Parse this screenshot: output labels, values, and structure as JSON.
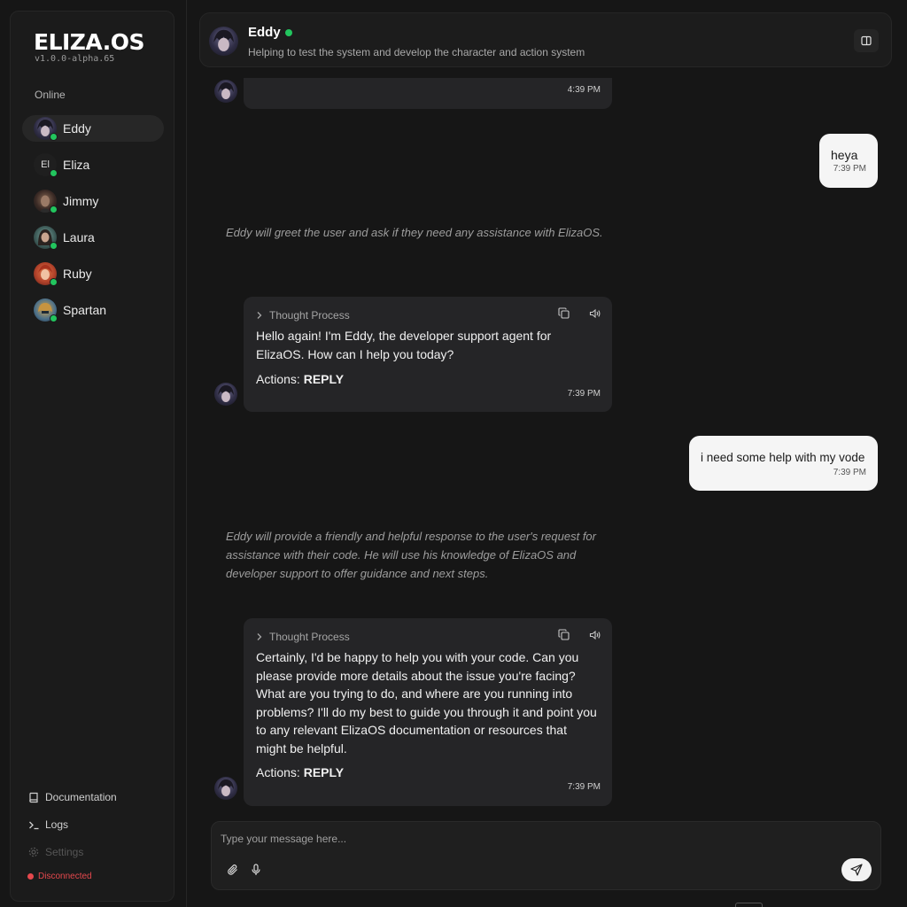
{
  "sidebar": {
    "logo": "ELIZA.OS",
    "version": "v1.0.0-alpha.65",
    "section_label": "Online",
    "agents": [
      {
        "name": "Eddy",
        "initials": ""
      },
      {
        "name": "Eliza",
        "initials": "El"
      },
      {
        "name": "Jimmy",
        "initials": ""
      },
      {
        "name": "Laura",
        "initials": ""
      },
      {
        "name": "Ruby",
        "initials": ""
      },
      {
        "name": "Spartan",
        "initials": ""
      }
    ],
    "links": {
      "documentation": "Documentation",
      "logs": "Logs",
      "settings": "Settings"
    },
    "connection_status": "Disconnected"
  },
  "header": {
    "name": "Eddy",
    "description": "Helping to test the system and develop the character and action system"
  },
  "messages": {
    "m0": {
      "time": "4:39 PM"
    },
    "m1": {
      "text": "heya",
      "time": "7:39 PM"
    },
    "t1": {
      "text": "Eddy will greet the user and ask if they need any assistance with ElizaOS."
    },
    "m2": {
      "thought_label": "Thought Process",
      "text": "Hello again! I'm Eddy, the developer support agent for ElizaOS. How can I help you today?",
      "actions_label": "Actions:",
      "actions_value": "REPLY",
      "time": "7:39 PM"
    },
    "m3": {
      "text": "i need some help with my vode",
      "time": "7:39 PM"
    },
    "t2": {
      "text": "Eddy will provide a friendly and helpful response to the user's request for assistance with their code. He will use his knowledge of ElizaOS and developer support to offer guidance and next steps."
    },
    "m4": {
      "thought_label": "Thought Process",
      "text": "Certainly, I'd be happy to help you with your code. Can you please provide more details about the issue you're facing? What are you trying to do, and where are you running into problems? I'll do my best to guide you through it and point you to any relevant ElizaOS documentation or resources that might be helpful.",
      "actions_label": "Actions:",
      "actions_value": "REPLY",
      "time": "7:39 PM"
    }
  },
  "composer": {
    "placeholder": "Type your message here..."
  },
  "colors": {
    "online": "#22c55e",
    "disconnected": "#e5484d",
    "agent_bubble": "#252527",
    "user_bubble": "#f5f5f5"
  }
}
